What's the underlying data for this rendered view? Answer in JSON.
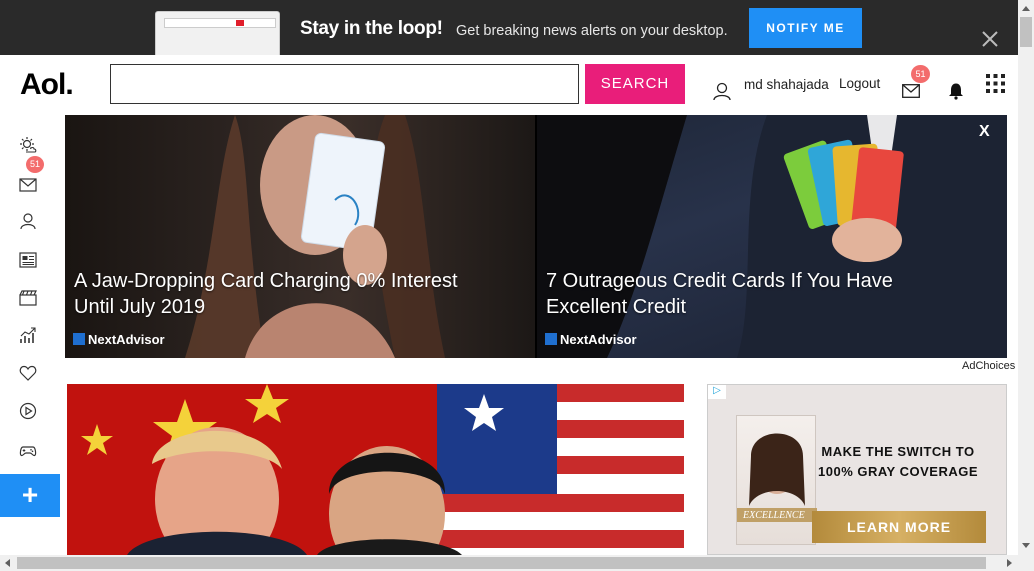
{
  "notification": {
    "title": "Stay in the loop!",
    "subtitle": "Get breaking news alerts on your desktop.",
    "button_label": "NOTIFY ME"
  },
  "header": {
    "logo": "Aol.",
    "search_value": "",
    "search_button_label": "SEARCH",
    "user_name": "md shahajada",
    "logout_label": "Logout",
    "mail_count": "51"
  },
  "sidebar": {
    "mail_count": "51",
    "items": [
      {
        "icon": "weather-icon"
      },
      {
        "icon": "mail-icon"
      },
      {
        "icon": "profile-icon"
      },
      {
        "icon": "news-icon"
      },
      {
        "icon": "video-icon"
      },
      {
        "icon": "finance-icon"
      },
      {
        "icon": "lifestyle-icon"
      },
      {
        "icon": "play-icon"
      },
      {
        "icon": "games-icon"
      }
    ],
    "plus_label": "+"
  },
  "ad_banner": {
    "left": {
      "headline": "A Jaw-Dropping Card Charging 0% Interest Until July 2019",
      "brand": "NextAdvisor"
    },
    "right": {
      "headline": "7 Outrageous Credit Cards If You Have Excellent Credit",
      "brand": "NextAdvisor"
    },
    "close_label": "X",
    "adchoices_label": "AdChoices"
  },
  "side_ad": {
    "copy": "MAKE THE SWITCH TO 100% GRAY COVERAGE",
    "cta_label": "LEARN MORE",
    "product_name": "EXCELLENCE"
  },
  "colors": {
    "accent_pink": "#e91e7a",
    "notify_blue": "#1f8ff5",
    "badge_red": "#f36c6c"
  }
}
